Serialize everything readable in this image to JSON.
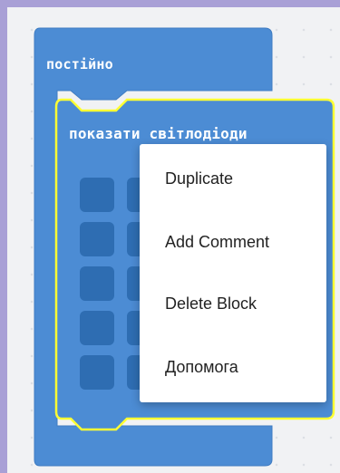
{
  "blocks": {
    "forever": {
      "label": "постійно",
      "color": "#4c8cd4"
    },
    "show_leds": {
      "label": "показати світлодіоди",
      "color": "#4c8cd4",
      "highlight_color": "#ffff33"
    },
    "led_color": "#2e6db2"
  },
  "context_menu": {
    "items": [
      {
        "label": "Duplicate"
      },
      {
        "label": "Add Comment"
      },
      {
        "label": "Delete Block"
      },
      {
        "label": "Допомога"
      }
    ]
  },
  "colors": {
    "outer_frame": "#a9a0d6",
    "workspace_bg": "#f1f2f4"
  }
}
